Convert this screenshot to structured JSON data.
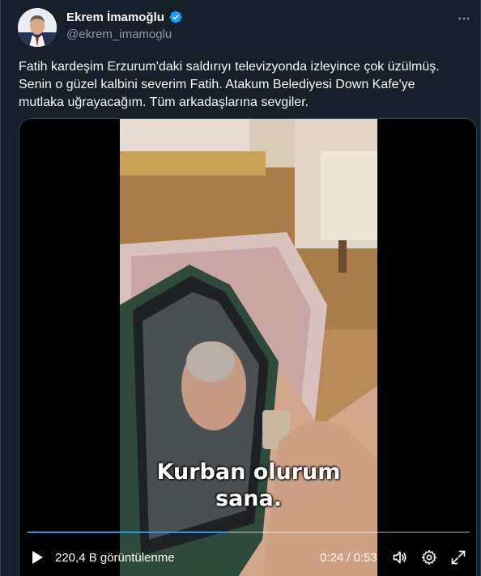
{
  "author": {
    "name": "Ekrem İmamoğlu",
    "handle": "@ekrem_imamoglu",
    "verified_color": "#1d9bf0"
  },
  "tweet": {
    "text": "Fatih kardeşim Erzurum'daki saldırıyı televizyonda izleyince çok üzülmüş.\nSenin o güzel kalbini severim Fatih. Atakum Belediyesi Down Kafe'ye\nmutlaka uğrayacağım. Tüm arkadaşlarına sevgiler."
  },
  "video": {
    "caption_line1": "Kurban olurum",
    "caption_line2": "sana.",
    "views": "220,4 B görüntülenme",
    "time": "0:24 / 0:53",
    "progress": 0.453
  },
  "icons": {
    "more": "more-icon",
    "play": "play-icon",
    "volume": "volume-icon",
    "settings": "settings-icon",
    "fullscreen": "fullscreen-icon"
  },
  "colors": {
    "background": "#15202b",
    "accent": "#1d9bf0",
    "secondary_text": "#8b98a5"
  }
}
